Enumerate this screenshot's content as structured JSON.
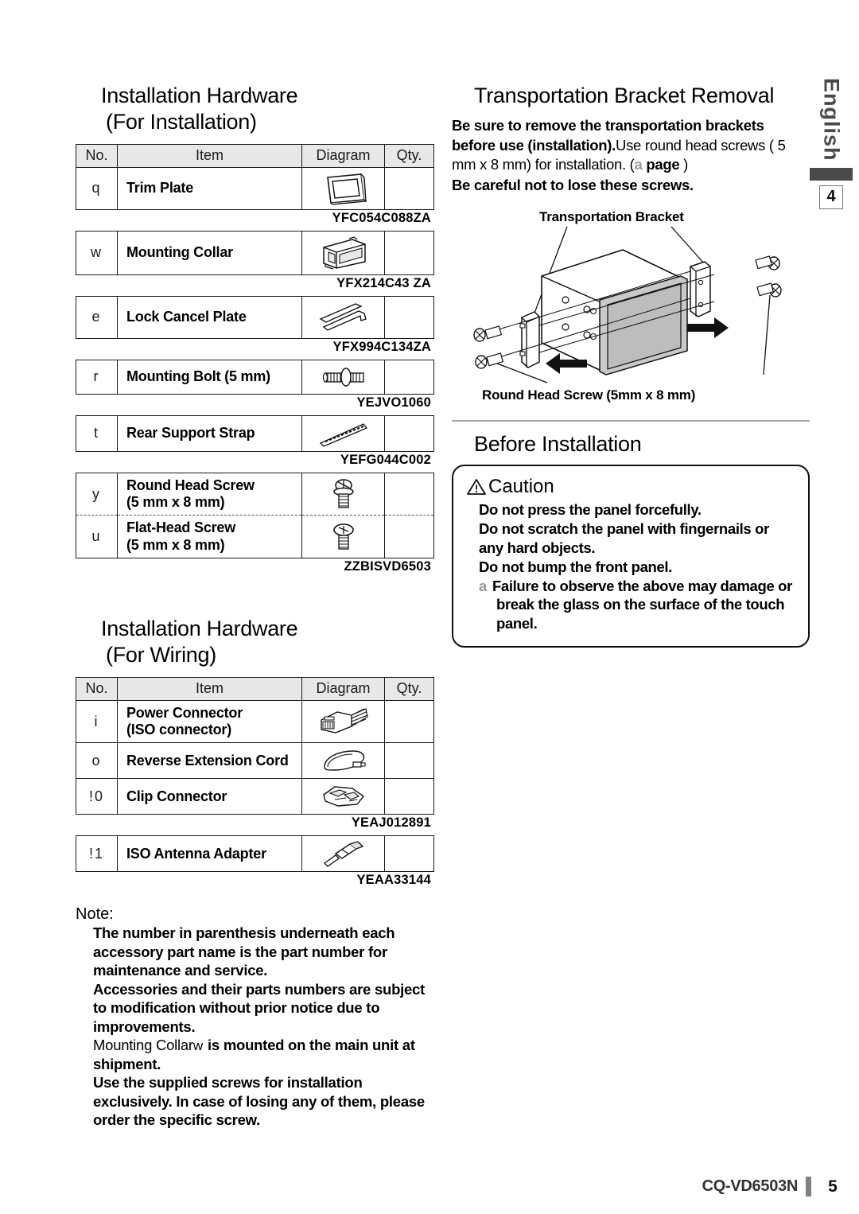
{
  "language_tab": {
    "label": "English",
    "chapter_number": "4"
  },
  "left": {
    "section1": {
      "title_line1": "Installation Hardware",
      "title_line2": "(For Installation)"
    },
    "table_headers": {
      "no": "No.",
      "item": "Item",
      "diagram": "Diagram",
      "qty": "Qty."
    },
    "install_rows": [
      {
        "no": "q",
        "item": "Trim Plate",
        "part_no": "YFC054C088ZA",
        "qty": "",
        "icon": "trim-plate-icon"
      },
      {
        "no": "w",
        "item": "Mounting Collar",
        "part_no": "YFX214C43  ZA",
        "qty": "",
        "icon": "mounting-collar-icon"
      },
      {
        "no": "e",
        "item": "Lock Cancel Plate",
        "part_no": "YFX994C134ZA",
        "qty": "",
        "icon": "lock-cancel-plate-icon"
      },
      {
        "no": "r",
        "item": "Mounting Bolt (5 mm)",
        "part_no": "YEJVO1060",
        "qty": "",
        "icon": "mounting-bolt-icon"
      },
      {
        "no": "t",
        "item": "Rear Support Strap",
        "part_no": "YEFG044C002",
        "qty": "",
        "icon": "rear-support-strap-icon"
      },
      {
        "no": "y",
        "item_line1": "Round Head Screw",
        "item_line2": "(5 mm x 8 mm)",
        "qty": "",
        "icon": "round-head-screw-icon"
      },
      {
        "no": "u",
        "item_line1": "Flat-Head Screw",
        "item_line2": "(5 mm x 8 mm)",
        "part_no": "ZZBISVD6503",
        "qty": "",
        "icon": "flat-head-screw-icon"
      }
    ],
    "section2": {
      "title_line1": "Installation Hardware",
      "title_line2": "(For Wiring)"
    },
    "wiring_rows": [
      {
        "no": "i",
        "item_line1": "Power Connector",
        "item_line2": "(ISO connector)",
        "qty": "",
        "icon": "power-connector-icon"
      },
      {
        "no": "o",
        "item": "Reverse Extension Cord",
        "qty": "",
        "icon": "reverse-extension-cord-icon"
      },
      {
        "no": "!0",
        "item": "Clip Connector",
        "part_no": "YEAJ012891",
        "qty": "",
        "icon": "clip-connector-icon"
      },
      {
        "no": "!1",
        "item": "ISO Antenna Adapter",
        "part_no": "YEAA33144",
        "qty": "",
        "icon": "iso-antenna-adapter-icon"
      }
    ],
    "note": {
      "label": "Note:",
      "items": [
        "The number in parenthesis underneath each accessory part name is the part number for maintenance and service.",
        "Accessories and their parts numbers are subject to modification without prior notice due to improvements.",
        "Use the supplied screws for installation exclusively. In case of losing any of them, please order the specific screw."
      ],
      "collar_note_pre": "Mounting Collar",
      "collar_note_mark": "w",
      "collar_note_post": " is mounted on the main unit at shipment."
    }
  },
  "right": {
    "section_bracket": {
      "title": "Transportation Bracket Removal",
      "line1_bold": "Be sure to remove the transportation brackets before use (installation).",
      "line1_reg": "Use round head screws ( 5 mm  x 8 mm) for installation.  (",
      "ref_mark": "a",
      "ref_label": "page",
      "ref_close": " )",
      "line2_bold": "Be careful not to lose these screws.",
      "figure": {
        "caption_bracket": "Transportation Bracket",
        "caption_screw": "Round Head Screw (5mm  x 8 mm)"
      }
    },
    "section_before": {
      "title": "Before Installation",
      "caution_label": "Caution",
      "lines": [
        "Do not press the panel forcefully.",
        "Do not scratch the panel with fingernails or any hard objects.",
        "Do not bump the front panel."
      ],
      "ref_mark": "a",
      "ref_line": "Failure to observe the above may damage or break the glass on the surface of the touch panel."
    }
  },
  "footer": {
    "model": "CQ-VD6503N",
    "page": "5"
  }
}
